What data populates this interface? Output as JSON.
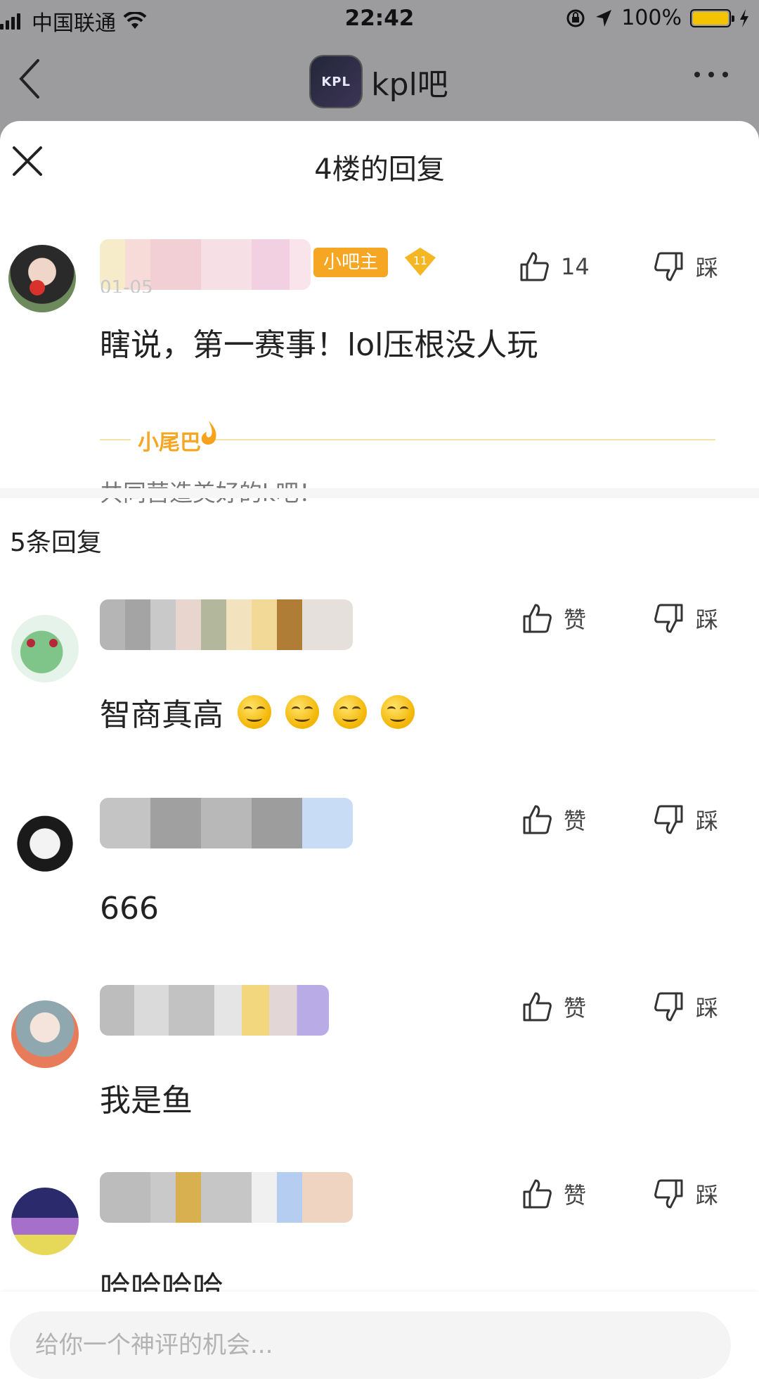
{
  "status_bar": {
    "carrier": "中国联通",
    "time": "22:42",
    "battery": "100%"
  },
  "nav": {
    "title": "kpl吧",
    "logo_text": "KPL"
  },
  "sheet": {
    "title": "4楼的回复"
  },
  "main_post": {
    "role_badge": "小吧主",
    "level": "11",
    "date": "01-05",
    "text": "瞎说，第一赛事！lol压根没人玩",
    "like_count": "14",
    "dislike_label": "踩",
    "tail_label": "小尾巴",
    "tail_text": "共同营造美好的k吧！"
  },
  "reply_count": "5条回复",
  "replies": [
    {
      "text": "智商真高",
      "like_label": "赞",
      "dislike_label": "踩",
      "emoji": "smug-face-emoji"
    },
    {
      "text": "666",
      "like_label": "赞",
      "dislike_label": "踩"
    },
    {
      "text": "我是鱼",
      "like_label": "赞",
      "dislike_label": "踩"
    },
    {
      "text": "哈哈哈哈",
      "like_label": "赞",
      "dislike_label": "踩"
    }
  ],
  "comment_input": {
    "placeholder": "给你一个神评的机会..."
  },
  "colors": {
    "badge_orange": "#f5a623",
    "accent_yellow": "#f5c400",
    "overlay_gray": "#9c9c9f"
  }
}
